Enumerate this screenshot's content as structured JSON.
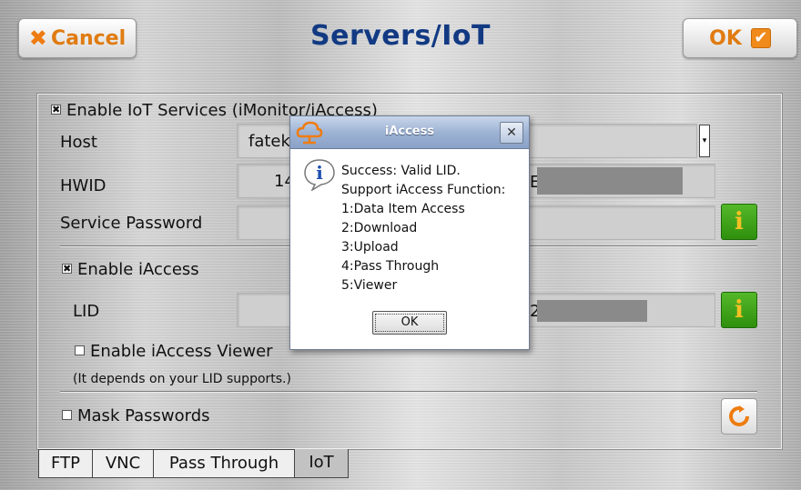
{
  "header": {
    "title": "Servers/IoT",
    "cancel_label": "Cancel",
    "ok_label": "OK"
  },
  "iot": {
    "enable_label": "Enable IoT Services (iMonitor/iAccess)",
    "enable_checked": true,
    "host_label": "Host",
    "host_value": "fatek",
    "hwid_label": "HWID",
    "hwid_value": "14",
    "hwid_tail": "E-",
    "password_label": "Service Password"
  },
  "iaccess": {
    "enable_label": "Enable iAccess",
    "enable_checked": true,
    "lid_label": "LID",
    "lid_tail": "2",
    "viewer_label": "Enable iAccess Viewer",
    "viewer_checked": false,
    "note": "(It depends on your LID supports.)"
  },
  "mask": {
    "label": "Mask Passwords",
    "checked": false
  },
  "tabs": [
    {
      "label": "FTP",
      "active": false
    },
    {
      "label": "VNC",
      "active": false
    },
    {
      "label": "Pass Through",
      "active": false
    },
    {
      "label": "IoT",
      "active": true
    }
  ],
  "dialog": {
    "title": "iAccess",
    "lines": [
      "Success: Valid LID.",
      "Support iAccess Function:",
      "1:Data Item Access",
      "2:Download",
      "3:Upload",
      "4:Pass Through",
      "5:Viewer"
    ],
    "ok_label": "OK"
  },
  "colors": {
    "title": "#123a83",
    "accent_orange": "#f08a1a",
    "info_green": "#3a9c14"
  },
  "icons": {
    "cancel": "x-icon",
    "ok": "checkbox-checked-icon",
    "info": "info-icon",
    "refresh": "refresh-icon",
    "dialog": "information-icon",
    "app_logo": "cloud-logo-icon"
  }
}
